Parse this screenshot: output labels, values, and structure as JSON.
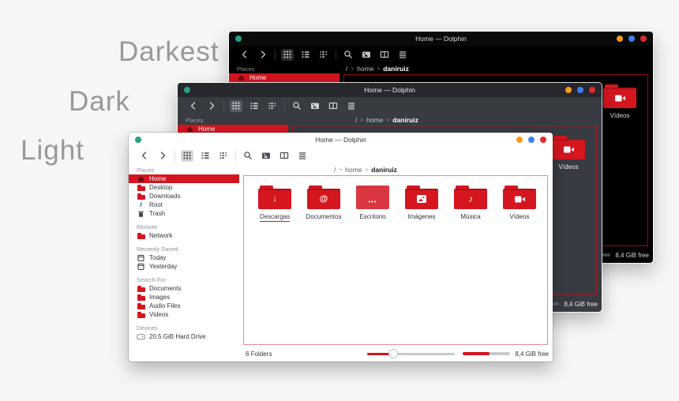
{
  "background": {
    "labels": {
      "darkest": "Darkest",
      "dark": "Dark",
      "light": "Light"
    }
  },
  "colors": {
    "accent_red": "#d3151f",
    "menu_dot_green": "#26a187",
    "control_orange": "#f99b1d",
    "control_blue": "#4080f0",
    "control_red": "#df2c2c"
  },
  "win": {
    "title": "Home — Dolphin",
    "toolbar": {
      "icons": [
        "back",
        "forward",
        "grid-view",
        "list-view",
        "compact-view",
        "search",
        "preview",
        "split-view",
        "menu"
      ]
    },
    "crumbs": {
      "root": "/",
      "chevron": ">",
      "home": "home",
      "user": "daniruiz"
    },
    "sections": [
      {
        "label": "Places",
        "items": [
          {
            "label": "Home",
            "icon": "home-icon",
            "selected": true
          },
          {
            "label": "Desktop",
            "icon": "folder-icon"
          },
          {
            "label": "Downloads",
            "icon": "folder-icon"
          },
          {
            "label": "Root",
            "icon": "root-icon"
          },
          {
            "label": "Trash",
            "icon": "trash-icon"
          }
        ]
      },
      {
        "label": "Remote",
        "items": [
          {
            "label": "Network",
            "icon": "folder-icon"
          }
        ]
      },
      {
        "label": "Recently Saved",
        "items": [
          {
            "label": "Today",
            "icon": "calendar-icon"
          },
          {
            "label": "Yesterday",
            "icon": "calendar-icon"
          }
        ]
      },
      {
        "label": "Search For",
        "items": [
          {
            "label": "Documents",
            "icon": "folder-icon"
          },
          {
            "label": "Images",
            "icon": "folder-icon"
          },
          {
            "label": "Audio Files",
            "icon": "folder-icon"
          },
          {
            "label": "Videos",
            "icon": "folder-icon"
          }
        ]
      },
      {
        "label": "Devices",
        "items": [
          {
            "label": "20,5 GiB Hard Drive",
            "icon": "harddrive-icon"
          }
        ]
      }
    ],
    "folders": [
      {
        "name": "Descargas",
        "glyph": "↓",
        "icon": "download-folder-icon",
        "selected": true
      },
      {
        "name": "Documentos",
        "glyph": "@",
        "icon": "documents-folder-icon"
      },
      {
        "name": "Escritorio",
        "glyph": "•••",
        "icon": "desktop-folder-icon"
      },
      {
        "name": "Imágenes",
        "glyph": "",
        "icon": "images-folder-icon"
      },
      {
        "name": "Música",
        "glyph": "♪",
        "icon": "music-folder-icon"
      },
      {
        "name": "Vídeos",
        "glyph": "",
        "icon": "videos-folder-icon"
      }
    ],
    "status": {
      "count": "6 Folders",
      "free": "8,4 GiB free"
    }
  }
}
